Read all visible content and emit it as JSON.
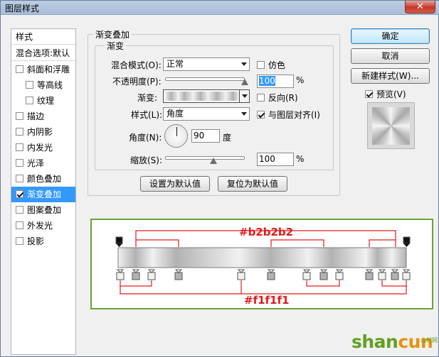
{
  "window": {
    "title": "图层样式",
    "close_label": "✕"
  },
  "left_list": {
    "header": "样式",
    "blend_options": "混合选项:默认",
    "items": [
      {
        "label": "斜面和浮雕",
        "checked": false,
        "sub": false
      },
      {
        "label": "等高线",
        "checked": false,
        "sub": true
      },
      {
        "label": "纹理",
        "checked": false,
        "sub": true
      },
      {
        "label": "描边",
        "checked": false,
        "sub": false
      },
      {
        "label": "内阴影",
        "checked": false,
        "sub": false
      },
      {
        "label": "内发光",
        "checked": false,
        "sub": false
      },
      {
        "label": "光泽",
        "checked": false,
        "sub": false
      },
      {
        "label": "颜色叠加",
        "checked": false,
        "sub": false
      },
      {
        "label": "渐变叠加",
        "checked": true,
        "sub": false,
        "selected": true
      },
      {
        "label": "图案叠加",
        "checked": false,
        "sub": false
      },
      {
        "label": "外发光",
        "checked": false,
        "sub": false
      },
      {
        "label": "投影",
        "checked": false,
        "sub": false
      }
    ]
  },
  "panel": {
    "section_title": "渐变叠加",
    "group_title": "渐变",
    "blend_mode": {
      "label": "混合模式(O):",
      "value": "正常"
    },
    "dither": {
      "label": "仿色",
      "checked": false
    },
    "opacity": {
      "label": "不透明度(P):",
      "value": "100",
      "unit": "%",
      "level": 1.0
    },
    "gradient": {
      "label": "渐变:"
    },
    "reverse": {
      "label": "反向(R)",
      "checked": false
    },
    "style": {
      "label": "样式(L):",
      "value": "角度"
    },
    "align": {
      "label": "与图层对齐(I)",
      "checked": true
    },
    "angle": {
      "label": "角度(N):",
      "value": "90",
      "unit": "度"
    },
    "scale": {
      "label": "缩放(S):",
      "value": "100",
      "unit": "%",
      "level": 0.5
    },
    "set_default": "设置为默认值",
    "reset_default": "复位为默认值"
  },
  "right": {
    "ok": "确定",
    "cancel": "取消",
    "new_style": "新建样式(W)...",
    "preview": {
      "label": "预览(V)",
      "checked": true
    }
  },
  "annotation": {
    "top_color": "#b2b2b2",
    "bottom_color": "#f1f1f1",
    "colors": {
      "light": "#f1f1f1",
      "dark": "#b2b2b2",
      "accent": "#e31b1b",
      "border": "#6aa236"
    }
  },
  "watermark": {
    "main": "shan",
    "accent": "cun",
    "suffix": "山村网"
  }
}
